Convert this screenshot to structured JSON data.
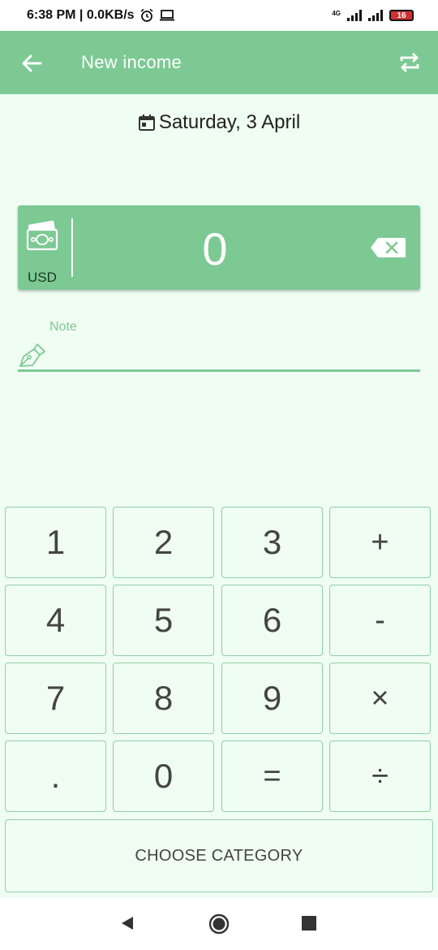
{
  "status_bar": {
    "time_speed": "6:38 PM | 0.0KB/s",
    "alarm_icon": "alarm-clock-icon",
    "laptop_icon": "laptop-icon",
    "network_label": "4G",
    "battery": "16"
  },
  "toolbar": {
    "title": "New income",
    "back_icon": "arrow-left-icon",
    "swap_icon": "repeat-icon",
    "color": "#7dc994"
  },
  "date": {
    "icon": "calendar-icon",
    "text": "Saturday, 3 April"
  },
  "amount": {
    "currency": "USD",
    "value": "0",
    "money_icon": "banknotes-icon",
    "backspace_icon": "backspace-icon"
  },
  "note": {
    "label": "Note",
    "value": "",
    "icon": "pen-icon"
  },
  "keypad": {
    "keys": [
      "1",
      "2",
      "3",
      "+",
      "4",
      "5",
      "6",
      "-",
      "7",
      "8",
      "9",
      "×",
      ".",
      "0",
      "=",
      "÷"
    ]
  },
  "category_button": "CHOOSE CATEGORY",
  "nav": {
    "back": "triangle-back-icon",
    "home": "circle-home-icon",
    "recent": "square-recents-icon"
  },
  "colors": {
    "accent": "#7dc994",
    "background": "#f0fdf3",
    "key_border": "#8fd0a3"
  }
}
